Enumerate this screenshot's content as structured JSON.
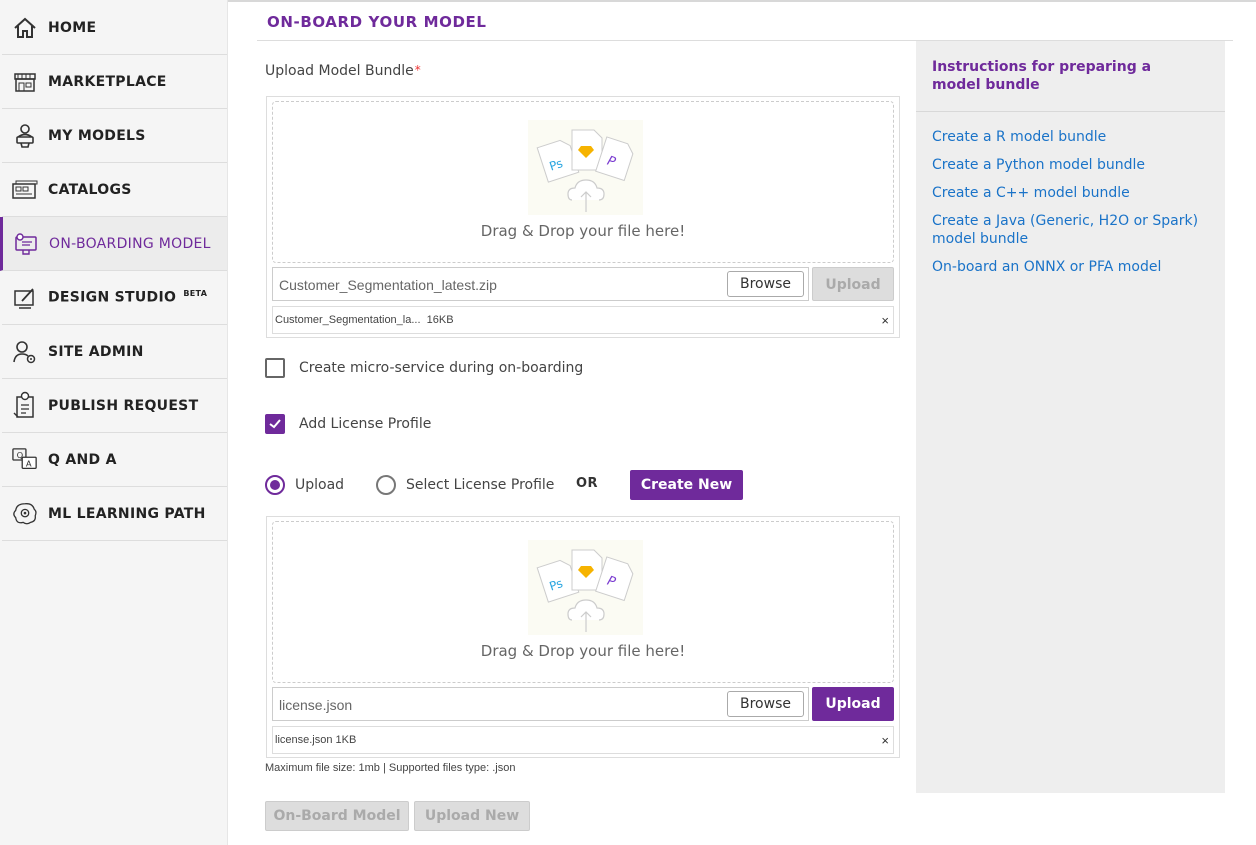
{
  "sidebar": {
    "items": [
      {
        "label": "HOME",
        "icon": "home-icon"
      },
      {
        "label": "MARKETPLACE",
        "icon": "storefront-icon"
      },
      {
        "label": "MY MODELS",
        "icon": "user-models-icon"
      },
      {
        "label": "CATALOGS",
        "icon": "catalog-icon"
      },
      {
        "label": "ON-BOARDING MODEL",
        "icon": "onboarding-icon",
        "active": true
      },
      {
        "label": "DESIGN STUDIO",
        "badge": "BETA",
        "icon": "design-studio-icon"
      },
      {
        "label": "SITE ADMIN",
        "icon": "admin-user-icon"
      },
      {
        "label": "PUBLISH REQUEST",
        "icon": "publish-request-icon"
      },
      {
        "label": "Q AND A",
        "icon": "qa-chat-icon"
      },
      {
        "label": "ML LEARNING PATH",
        "icon": "brain-gear-icon"
      }
    ]
  },
  "main": {
    "title": "ON-BOARD YOUR MODEL",
    "upload_label": "Upload Model Bundle",
    "required_mark": "*",
    "model_upload": {
      "drop_text": "Drag & Drop your file here!",
      "file_name": "Customer_Segmentation_latest.zip",
      "browse_label": "Browse",
      "upload_label": "Upload",
      "upload_enabled": false,
      "chip_name": "Customer_Segmentation_la...",
      "chip_size": "16KB",
      "chip_close": "×"
    },
    "microservice_checkbox": {
      "label": "Create micro-service during on-boarding",
      "checked": false
    },
    "license_checkbox": {
      "label": "Add License Profile",
      "checked": true
    },
    "license_options": {
      "upload_label": "Upload",
      "select_label": "Select License Profile",
      "selected": "upload",
      "or_label": "OR",
      "create_new_label": "Create New"
    },
    "license_upload": {
      "drop_text": "Drag & Drop your file here!",
      "file_name": "license.json",
      "browse_label": "Browse",
      "upload_label": "Upload",
      "upload_enabled": true,
      "chip_name": "license.json",
      "chip_size": "1KB",
      "chip_close": "×",
      "hint": "Maximum file size: 1mb | Supported files type: .json"
    },
    "footer": {
      "onboard_label": "On-Board Model",
      "upload_new_label": "Upload New"
    }
  },
  "instructions": {
    "title": "Instructions for preparing a model bundle",
    "links": [
      "Create a R model bundle",
      "Create a Python model bundle",
      "Create a C++ model bundle",
      "Create a Java (Generic, H2O or Spark) model bundle",
      "On-board an ONNX or PFA model"
    ]
  },
  "colors": {
    "accent": "#6f2a9b",
    "link": "#1a73c8",
    "required": "#ee3333"
  }
}
